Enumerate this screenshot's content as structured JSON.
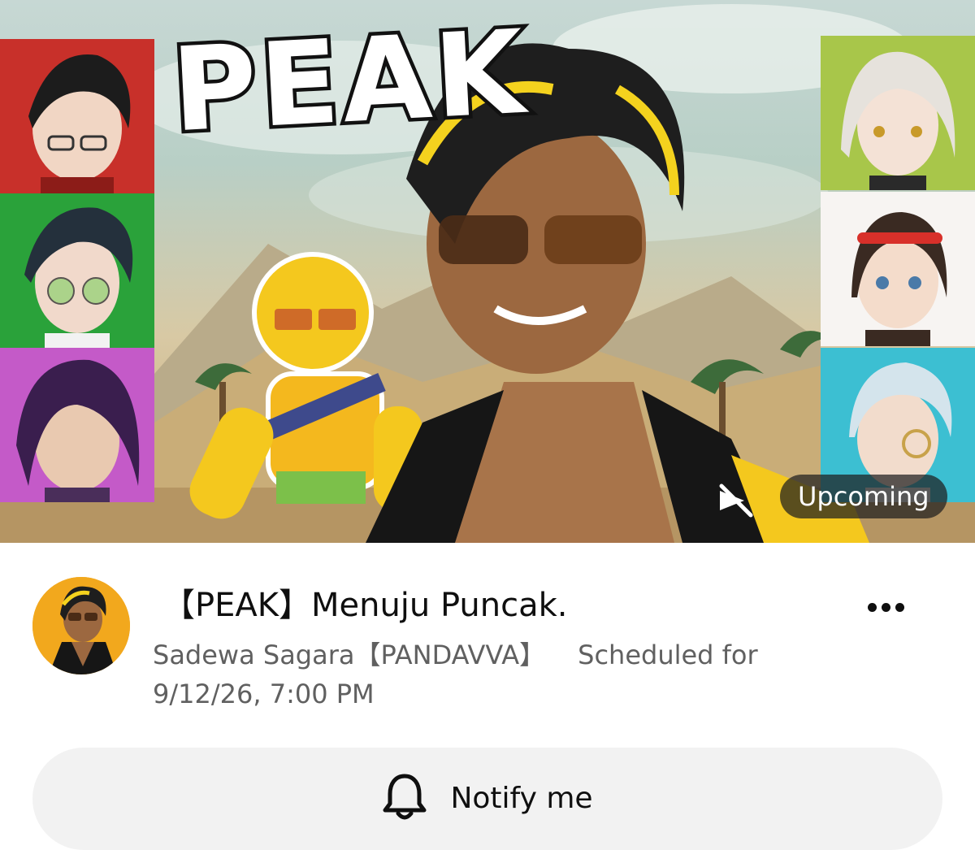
{
  "thumbnail": {
    "logo_text": "PEAK",
    "badge": "Upcoming",
    "panel_colors": [
      "#c8302a",
      "#2aa23a",
      "#c45ac8",
      "#a8c64a",
      "#f2f2f2",
      "#3cbfd2"
    ],
    "icons": {
      "mute": "mute-icon"
    }
  },
  "video": {
    "title": "【PEAK】Menuju Puncak.",
    "channel": "Sadewa Sagara【PANDAVVA】",
    "schedule_prefix": "Scheduled for",
    "schedule_datetime": "9/12/26, 7:00 PM"
  },
  "actions": {
    "more_icon": "more-vert-icon",
    "notify_label": "Notify me",
    "notify_icon": "bell-icon"
  }
}
